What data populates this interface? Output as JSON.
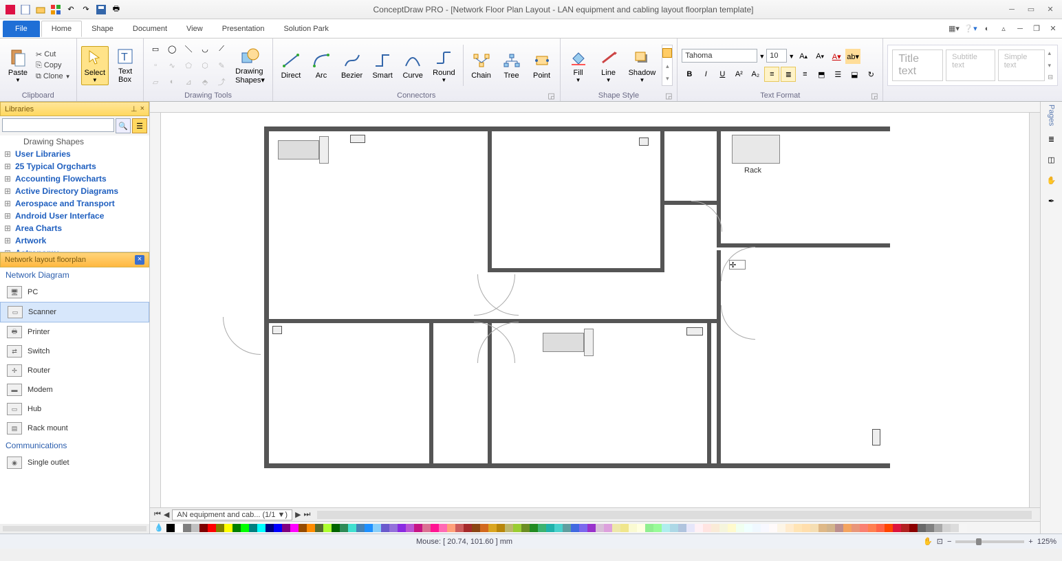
{
  "app": {
    "title": "ConceptDraw PRO - [Network Floor Plan Layout - LAN equipment and cabling layout floorplan template]"
  },
  "qat_icons": [
    "app",
    "new",
    "open",
    "grid",
    "undo",
    "redo",
    "save",
    "print"
  ],
  "win_icons": [
    "min",
    "max",
    "close"
  ],
  "tabs": {
    "file": "File",
    "items": [
      "Home",
      "Shape",
      "Document",
      "View",
      "Presentation",
      "Solution Park"
    ],
    "active": 0
  },
  "tabbar_right_icons": [
    "panel-toggle",
    "help",
    "style",
    "minimize-ribbon",
    "restore",
    "close-doc"
  ],
  "ribbon": {
    "clipboard": {
      "label": "Clipboard",
      "paste": "Paste",
      "cut": "Cut",
      "copy": "Copy",
      "clone": "Clone"
    },
    "select": {
      "label": "Select"
    },
    "textbox": {
      "label": "Text Box"
    },
    "drawing_tools": {
      "label": "Drawing Tools",
      "shapes": "Drawing Shapes"
    },
    "connectors": {
      "label": "Connectors",
      "items": [
        "Direct",
        "Arc",
        "Bezier",
        "Smart",
        "Curve",
        "Round"
      ],
      "items2": [
        "Chain",
        "Tree",
        "Point"
      ]
    },
    "shape_style": {
      "label": "Shape Style",
      "fill": "Fill",
      "line": "Line",
      "shadow": "Shadow"
    },
    "text_format": {
      "label": "Text Format",
      "font": "Tahoma",
      "size": "10"
    },
    "presets": {
      "title": "Title text",
      "subtitle": "Subtitle text",
      "simple": "Simple text"
    }
  },
  "libraries": {
    "header": "Libraries",
    "search_placeholder": "",
    "tree": [
      {
        "label": "Drawing Shapes",
        "plain": true
      },
      {
        "label": "User Libraries"
      },
      {
        "label": "25 Typical Orgcharts"
      },
      {
        "label": "Accounting Flowcharts"
      },
      {
        "label": "Active Directory Diagrams"
      },
      {
        "label": "Aerospace and Transport"
      },
      {
        "label": "Android User Interface"
      },
      {
        "label": "Area Charts"
      },
      {
        "label": "Artwork"
      },
      {
        "label": "Astronomy"
      }
    ],
    "shapes_header": "Network layout floorplan",
    "shape_cat": "Network Diagram",
    "shapes": [
      "PC",
      "Scanner",
      "Printer",
      "Switch",
      "Router",
      "Modem",
      "Hub",
      "Rack mount"
    ],
    "shape_cat2": "Communications",
    "shapes2": [
      "Single outlet"
    ]
  },
  "canvas": {
    "rack_label": "Rack",
    "sheet_tab": "AN equipment and cab... (1/1",
    "sheet_nav": [
      "first",
      "prev"
    ]
  },
  "right_panel": {
    "label": "Pages",
    "icons": [
      "pages",
      "layers",
      "shapes",
      "hand",
      "eyedrop"
    ]
  },
  "status": {
    "mouse": "Mouse: [ 20.74, 101.60 ] mm",
    "zoom": "125%"
  },
  "palette": [
    "#000000",
    "#ffffff",
    "#7f7f7f",
    "#c0c0c0",
    "#800000",
    "#ff0000",
    "#808000",
    "#ffff00",
    "#008000",
    "#00ff00",
    "#008080",
    "#00ffff",
    "#000080",
    "#0000ff",
    "#800080",
    "#ff00ff",
    "#964b00",
    "#ff8c00",
    "#556b2f",
    "#adff2f",
    "#006400",
    "#2e8b57",
    "#40e0d0",
    "#4682b4",
    "#1e90ff",
    "#87cefa",
    "#6a5acd",
    "#9370db",
    "#8a2be2",
    "#ba55d3",
    "#c71585",
    "#db7093",
    "#ff1493",
    "#ff69b4",
    "#ffa07a",
    "#cd5c5c",
    "#a52a2a",
    "#8b4513",
    "#d2691e",
    "#daa520",
    "#b8860b",
    "#bdb76b",
    "#9acd32",
    "#6b8e23",
    "#228b22",
    "#3cb371",
    "#20b2aa",
    "#48d1cc",
    "#5f9ea0",
    "#4169e1",
    "#7b68ee",
    "#9932cc",
    "#d8bfd8",
    "#dda0dd",
    "#eee8aa",
    "#f0e68c",
    "#fafad2",
    "#ffffe0",
    "#90ee90",
    "#98fb98",
    "#afeeee",
    "#add8e6",
    "#b0c4de",
    "#e6e6fa",
    "#fff0f5",
    "#ffe4e1",
    "#faebd7",
    "#f5f5dc",
    "#fffacd",
    "#f0fff0",
    "#f0ffff",
    "#f0f8ff",
    "#f8f8ff",
    "#fffafa",
    "#fdf5e6",
    "#ffebcd",
    "#ffe4b5",
    "#ffdead",
    "#f5deb3",
    "#deb887",
    "#d2b48c",
    "#bc8f8f",
    "#f4a460",
    "#e9967a",
    "#fa8072",
    "#ff7f50",
    "#ff6347",
    "#ff4500",
    "#dc143c",
    "#b22222",
    "#8b0000",
    "#696969",
    "#808080",
    "#a9a9a9",
    "#d3d3d3",
    "#dcdcdc",
    "#f5f5f5"
  ]
}
